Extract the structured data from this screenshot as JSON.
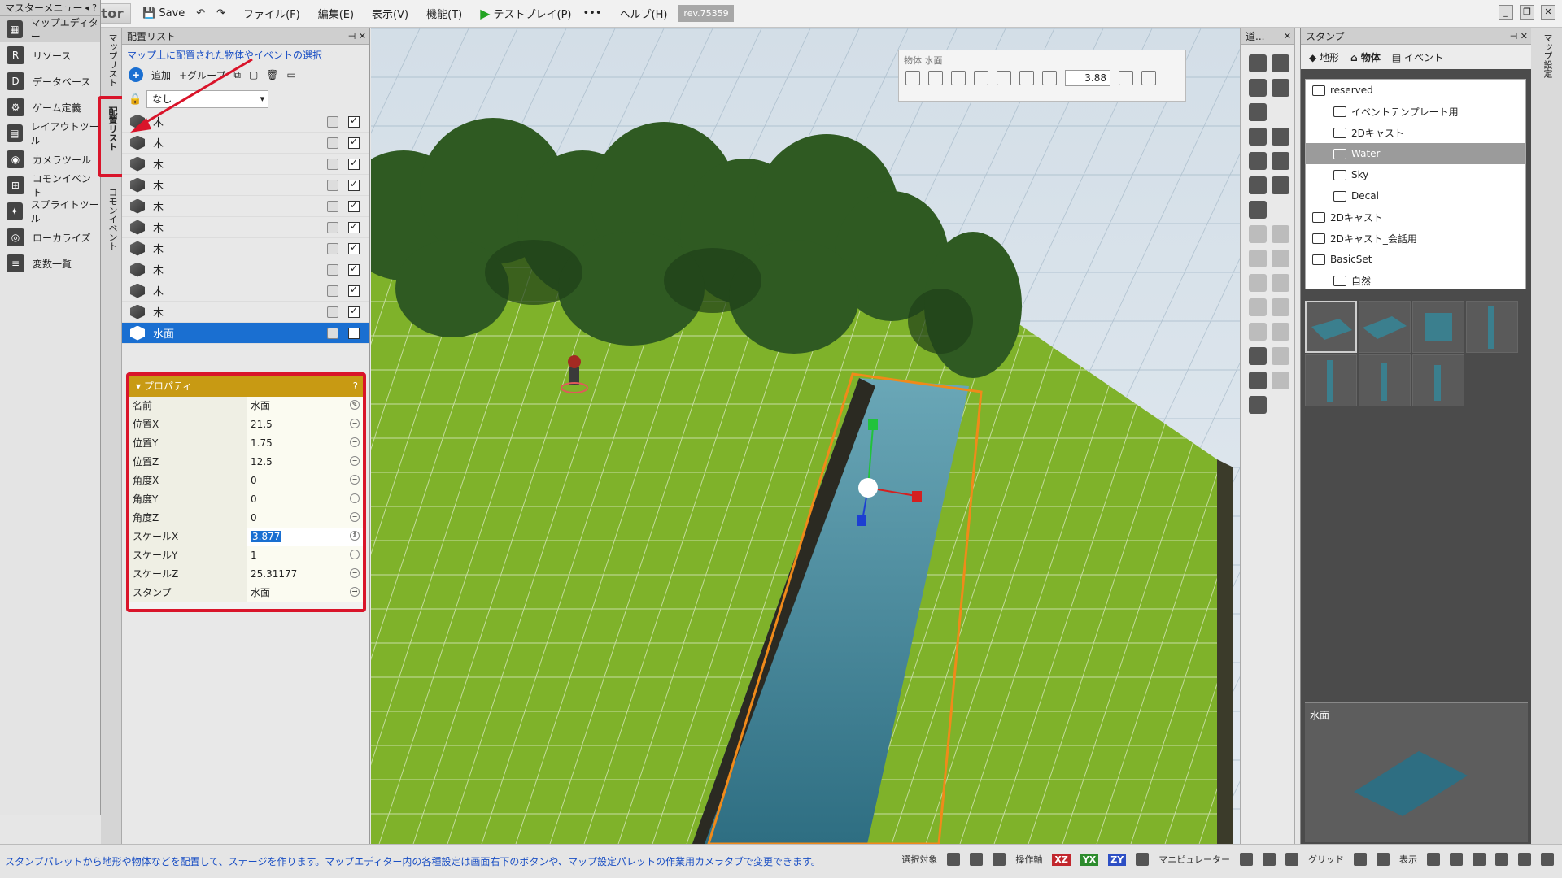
{
  "app": {
    "title": "Map Editor",
    "save": "Save",
    "menus": [
      "ファイル(F)",
      "編集(E)",
      "表示(V)",
      "機能(T)"
    ],
    "testplay": "テストプレイ(P)",
    "more": "•••",
    "help": "ヘルプ(H)",
    "rev": "rev.75359"
  },
  "master_menu": {
    "title": "マスターメニュー",
    "items": [
      {
        "label": "マップエディター",
        "icon": "map-editor-icon"
      },
      {
        "label": "リソース",
        "icon": "resource-icon"
      },
      {
        "label": "データベース",
        "icon": "database-icon"
      },
      {
        "label": "ゲーム定義",
        "icon": "game-def-icon"
      },
      {
        "label": "レイアウトツール",
        "icon": "layout-icon"
      },
      {
        "label": "カメラツール",
        "icon": "camera-icon"
      },
      {
        "label": "コモンイベント",
        "icon": "common-event-icon"
      },
      {
        "label": "スプライトツール",
        "icon": "sprite-icon"
      },
      {
        "label": "ローカライズ",
        "icon": "localize-icon"
      },
      {
        "label": "変数一覧",
        "icon": "variables-icon"
      }
    ]
  },
  "vertical_tabs": {
    "map_list": "マップリスト",
    "placement_list": "配置リスト",
    "common_event": "コモンイベント"
  },
  "placement": {
    "title": "配置リスト",
    "hint": "マップ上に配置された物体やイベントの選択",
    "add": "追加",
    "group": "+グループ",
    "filter": "なし",
    "items": [
      "木",
      "木",
      "木",
      "木",
      "木",
      "木",
      "木",
      "木",
      "木",
      "木",
      "水面"
    ],
    "selected_index": 10
  },
  "properties": {
    "title": "プロパティ",
    "help": "?",
    "rows": [
      {
        "key": "名前",
        "value": "水面"
      },
      {
        "key": "位置X",
        "value": "21.5"
      },
      {
        "key": "位置Y",
        "value": "1.75"
      },
      {
        "key": "位置Z",
        "value": "12.5"
      },
      {
        "key": "角度X",
        "value": "0"
      },
      {
        "key": "角度Y",
        "value": "0"
      },
      {
        "key": "角度Z",
        "value": "0"
      },
      {
        "key": "スケールX",
        "value": "3.877"
      },
      {
        "key": "スケールY",
        "value": "1"
      },
      {
        "key": "スケールZ",
        "value": "25.31177"
      },
      {
        "key": "スタンプ",
        "value": "水面"
      }
    ],
    "editing_index": 7
  },
  "object_toolbar": {
    "title": "物体 水面",
    "value": "3.88"
  },
  "tools_panel": {
    "title": "道..."
  },
  "stamp": {
    "title": "スタンプ",
    "tabs": [
      "地形",
      "物体",
      "イベント"
    ],
    "tree": [
      {
        "label": "reserved",
        "level": 0
      },
      {
        "label": "イベントテンプレート用",
        "level": 1
      },
      {
        "label": "2Dキャスト",
        "level": 1
      },
      {
        "label": "Water",
        "level": 1
      },
      {
        "label": "Sky",
        "level": 1
      },
      {
        "label": "Decal",
        "level": 1
      },
      {
        "label": "2Dキャスト",
        "level": 0
      },
      {
        "label": "2Dキャスト_会話用",
        "level": 0
      },
      {
        "label": "BasicSet",
        "level": 0
      },
      {
        "label": "自然",
        "level": 1
      }
    ],
    "selected_tree_index": 3,
    "preview_name": "水面"
  },
  "right_edge_label": "マップ設定",
  "status": {
    "message": "スタンプパレットから地形や物体などを配置して、ステージを作ります。マップエディター内の各種設定は画面右下のボタンや、マップ設定パレットの作業用カメラタブで変更できます。",
    "select_target": "選択対象",
    "axis_label": "操作軸",
    "axes": [
      "XZ",
      "YX",
      "ZY"
    ],
    "manipulator": "マニピュレーター",
    "grid": "グリッド",
    "view": "表示"
  },
  "colors": {
    "selection": "#1a6fd1",
    "annotation": "#d9142a",
    "property_header": "#c89a13",
    "grass": "#7fb22a",
    "water": "#3a7f93"
  }
}
